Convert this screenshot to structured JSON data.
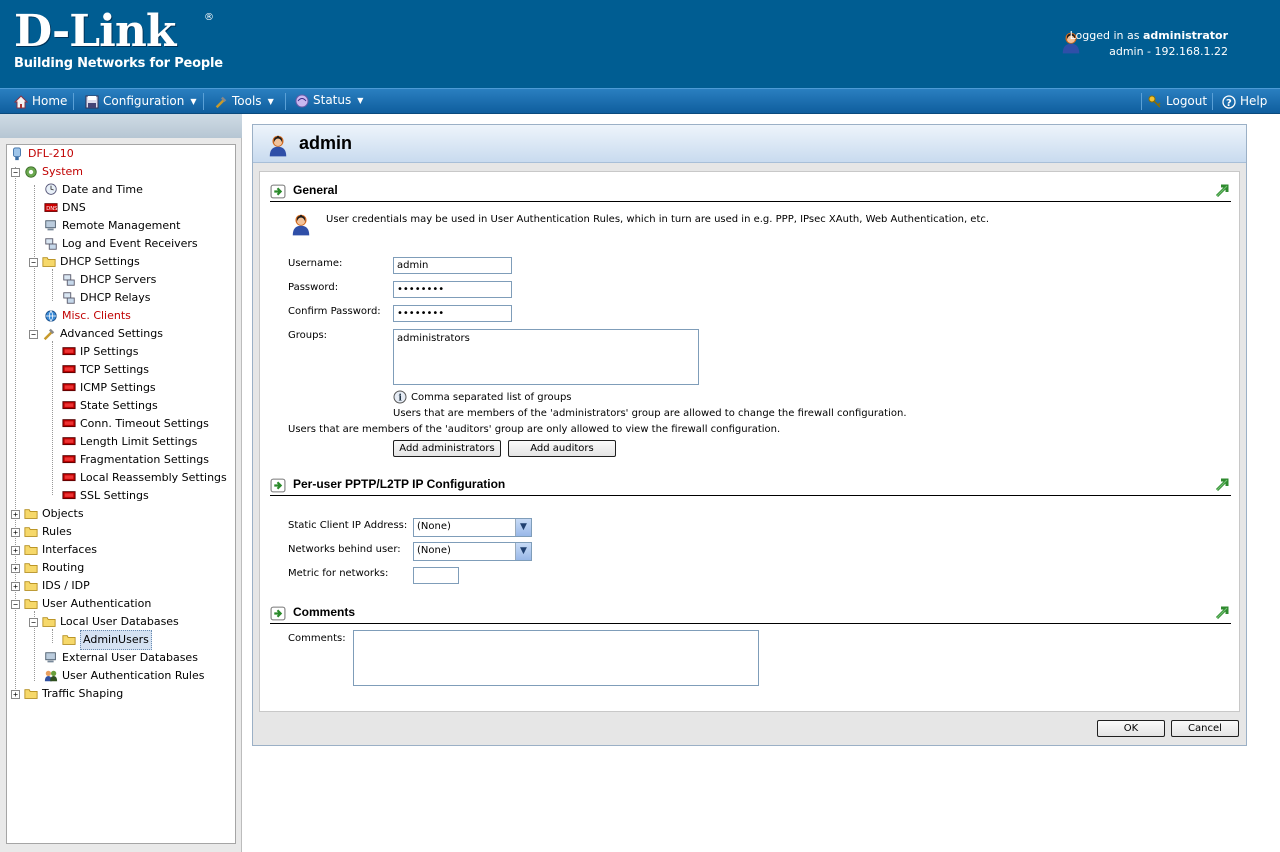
{
  "header": {
    "logo_text": "D-Link",
    "logo_reg": "®",
    "logo_tagline": "Building Networks for People",
    "logged_in_prefix": "Logged in as ",
    "logged_in_user": "administrator",
    "session_info": "admin - 192.168.1.22"
  },
  "menu": {
    "home": "Home",
    "configuration": "Configuration",
    "tools": "Tools",
    "status": "Status",
    "logout": "Logout",
    "help": "Help"
  },
  "tree": {
    "root": "DFL-210",
    "system": "System",
    "date_time": "Date and Time",
    "dns": "DNS",
    "remote_mgmt": "Remote Management",
    "log_receivers": "Log and Event Receivers",
    "dhcp_settings": "DHCP Settings",
    "dhcp_servers": "DHCP Servers",
    "dhcp_relays": "DHCP Relays",
    "misc_clients": "Misc. Clients",
    "advanced_settings": "Advanced Settings",
    "ip_settings": "IP Settings",
    "tcp_settings": "TCP Settings",
    "icmp_settings": "ICMP Settings",
    "state_settings": "State Settings",
    "conn_timeout": "Conn. Timeout Settings",
    "length_limit": "Length Limit Settings",
    "fragmentation": "Fragmentation Settings",
    "local_reassembly": "Local Reassembly Settings",
    "ssl_settings": "SSL Settings",
    "objects": "Objects",
    "rules": "Rules",
    "interfaces": "Interfaces",
    "routing": "Routing",
    "ids_idp": "IDS / IDP",
    "user_auth": "User Authentication",
    "local_user_db": "Local User Databases",
    "admin_users": "AdminUsers",
    "external_user_db": "External User Databases",
    "user_auth_rules": "User Authentication Rules",
    "traffic_shaping": "Traffic Shaping"
  },
  "page": {
    "title": "admin",
    "general": {
      "title": "General",
      "description": "User credentials may be used in User Authentication Rules, which in turn are used in e.g. PPP, IPsec XAuth, Web Authentication, etc.",
      "username_label": "Username:",
      "username_value": "admin",
      "password_label": "Password:",
      "password_value": "********",
      "confirm_label": "Confirm Password:",
      "confirm_value": "********",
      "groups_label": "Groups:",
      "groups_value": "administrators",
      "groups_hint": "Comma separated list of groups",
      "admin_note": "Users that are members of the 'administrators' group are allowed to change the firewall configuration.",
      "auditor_note": "Users that are members of the 'auditors' group are only allowed to view the firewall configuration.",
      "add_admins_button": "Add administrators",
      "add_auditors_button": "Add auditors"
    },
    "pptp": {
      "title": "Per-user PPTP/L2TP IP Configuration",
      "static_ip_label": "Static Client IP Address:",
      "static_ip_value": "(None)",
      "networks_label": "Networks behind user:",
      "networks_value": "(None)",
      "metric_label": "Metric for networks:",
      "metric_value": ""
    },
    "comments": {
      "title": "Comments",
      "comments_label": "Comments:",
      "comments_value": ""
    },
    "ok_button": "OK",
    "cancel_button": "Cancel"
  }
}
